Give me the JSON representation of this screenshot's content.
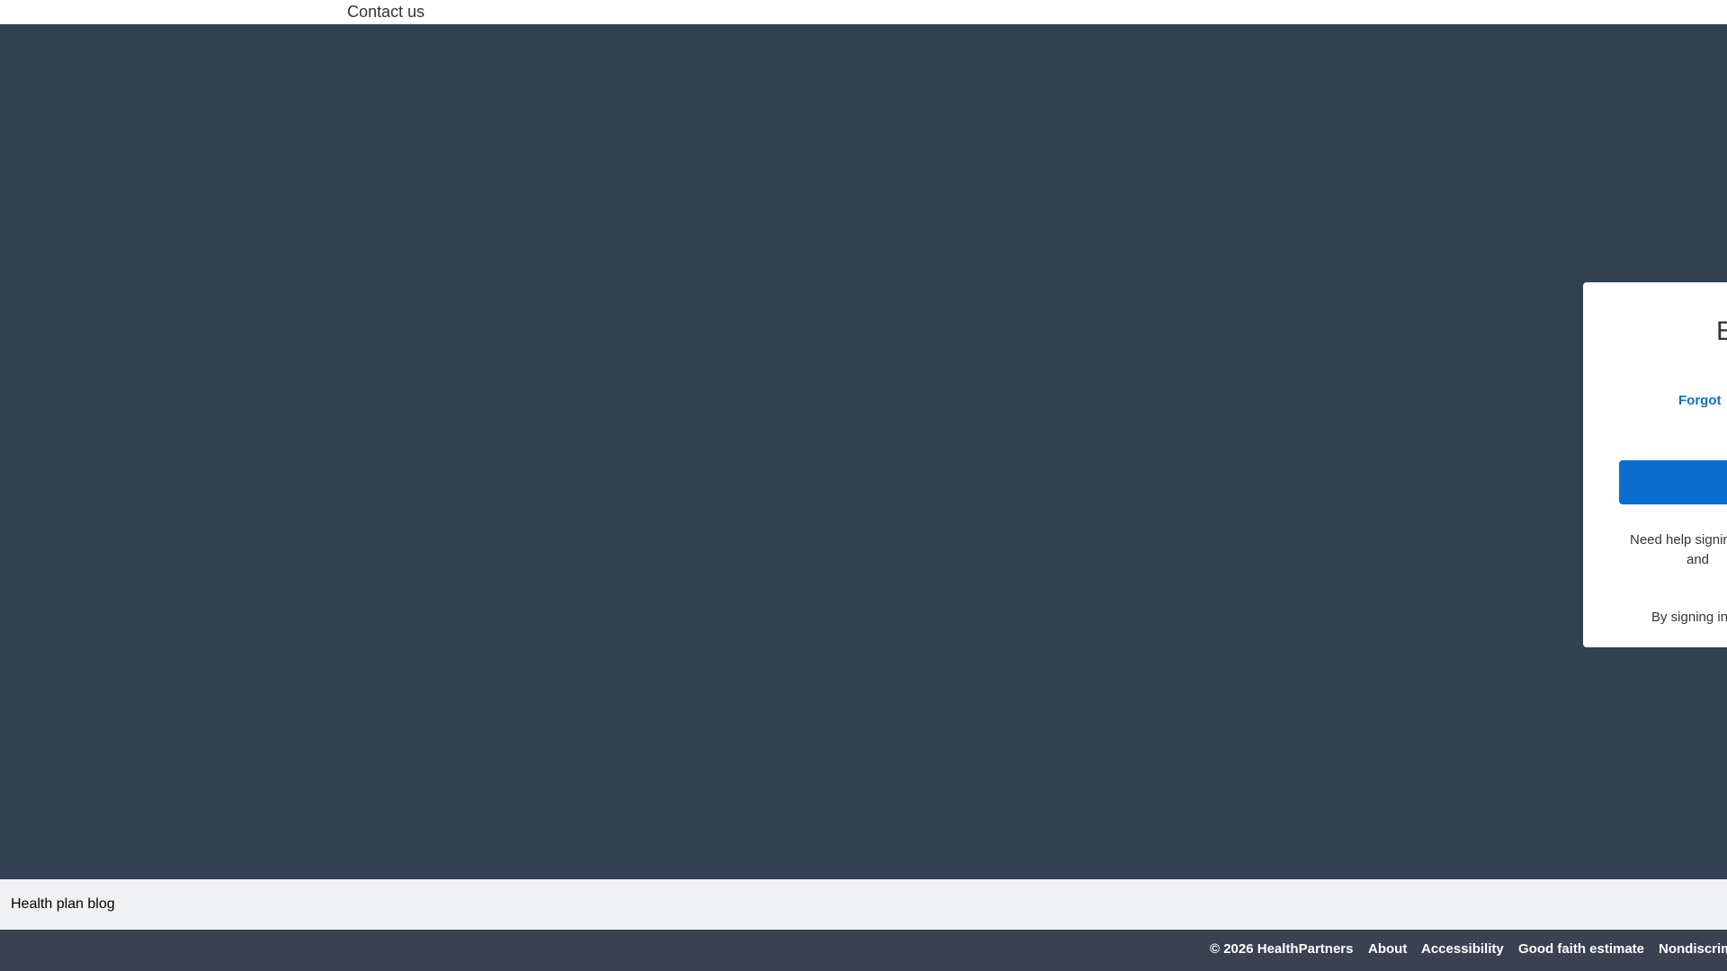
{
  "top_bar": {
    "contact_label": "Contact us"
  },
  "signin_card": {
    "heading": "E",
    "forgot_link": "Forgot",
    "help_line_1": "Need help signin",
    "help_line_2": "and",
    "terms": "By signing in"
  },
  "blog_bar": {
    "label": "Health plan blog"
  },
  "footer": {
    "copyright": "© 2026 HealthPartners",
    "links": [
      "About",
      "Accessibility",
      "Good faith estimate",
      "Nondiscrim"
    ]
  },
  "colors": {
    "hero_background": "#324054",
    "primary_button": "#0a6ed1",
    "link_blue": "#0b72c8",
    "footer_background": "#3b4150",
    "blog_bar_background": "#f0f1f2"
  }
}
